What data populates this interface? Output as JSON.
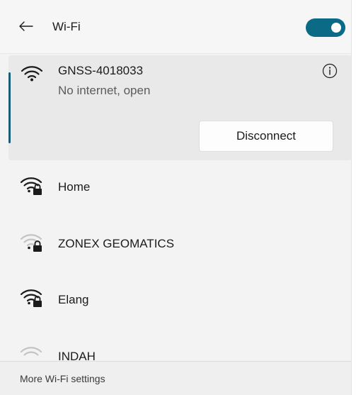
{
  "header": {
    "title": "Wi-Fi",
    "wifi_enabled": true
  },
  "connected_network": {
    "name": "GNSS-4018033",
    "status": "No internet, open",
    "disconnect_label": "Disconnect",
    "signal_icon": "wifi-full-icon"
  },
  "networks": [
    {
      "name": "Home",
      "secured": true,
      "signal": "strong"
    },
    {
      "name": "ZONEX GEOMATICS",
      "secured": true,
      "signal": "weak"
    },
    {
      "name": "Elang",
      "secured": true,
      "signal": "strong"
    },
    {
      "name": "INDAH",
      "secured": false,
      "signal": "weak"
    }
  ],
  "footer": {
    "settings_link": "More Wi-Fi settings"
  },
  "colors": {
    "accent": "#0b6a86",
    "panel_bg": "#f3f3f3",
    "selected_bg": "#e9e9e9"
  }
}
